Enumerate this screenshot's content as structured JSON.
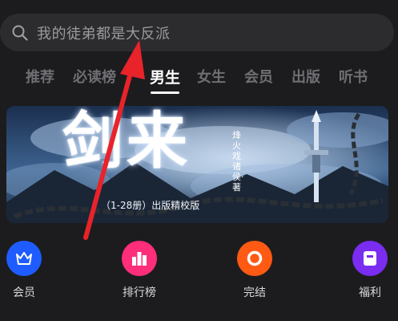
{
  "search": {
    "placeholder": "我的徒弟都是大反派",
    "icon": "search-icon"
  },
  "tabs": [
    {
      "label": "推荐",
      "active": false
    },
    {
      "label": "必读榜",
      "active": false
    },
    {
      "label": "男生",
      "active": true
    },
    {
      "label": "女生",
      "active": false
    },
    {
      "label": "会员",
      "active": false
    },
    {
      "label": "出版",
      "active": false
    },
    {
      "label": "听书",
      "active": false
    }
  ],
  "banner": {
    "title": "剑来",
    "author_line": "烽火戏诸侯·著",
    "subtitle": "（1-28册）出版精校版"
  },
  "quick_menu": [
    {
      "label": "会员",
      "icon": "crown-icon",
      "color": "#1f5cff"
    },
    {
      "label": "排行榜",
      "icon": "bar-chart-icon",
      "color": "#ff2e7a"
    },
    {
      "label": "完结",
      "icon": "ring-icon",
      "color": "#ff5a14"
    },
    {
      "label": "福利",
      "icon": "gift-card-icon",
      "color": "#7a2cf0"
    }
  ],
  "colors": {
    "background": "#1c1c1e",
    "search_bg": "#2c2c2e",
    "arrow": "#e8232a"
  }
}
